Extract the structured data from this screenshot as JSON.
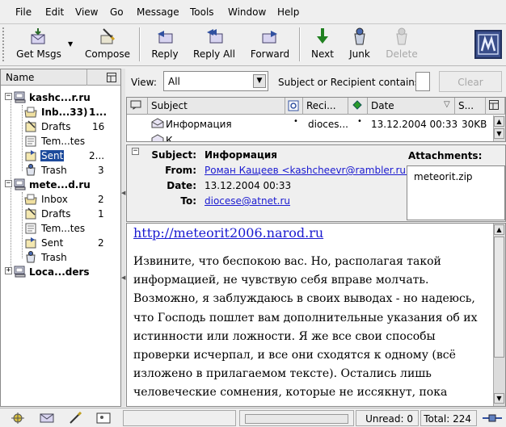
{
  "menubar": {
    "items": [
      "File",
      "Edit",
      "View",
      "Go",
      "Message",
      "Tools",
      "Window",
      "Help"
    ]
  },
  "toolbar": {
    "get_msgs": "Get Msgs",
    "compose": "Compose",
    "reply": "Reply",
    "reply_all": "Reply All",
    "forward": "Forward",
    "next": "Next",
    "junk": "Junk",
    "delete": "Delete"
  },
  "folder_pane": {
    "header": "Name",
    "accounts": [
      {
        "name": "kashc...r.ru",
        "folders": [
          {
            "name": "Inb...33)",
            "count": "1...",
            "bold": true
          },
          {
            "name": "Drafts",
            "count": "16"
          },
          {
            "name": "Tem...tes",
            "count": ""
          },
          {
            "name": "Sent",
            "count": "2...",
            "selected": true
          },
          {
            "name": "Trash",
            "count": "3"
          }
        ]
      },
      {
        "name": "mete...d.ru",
        "folders": [
          {
            "name": "Inbox",
            "count": "2"
          },
          {
            "name": "Drafts",
            "count": "1"
          },
          {
            "name": "Tem...tes",
            "count": ""
          },
          {
            "name": "Sent",
            "count": "2"
          },
          {
            "name": "Trash",
            "count": ""
          }
        ]
      },
      {
        "name": "Loca...ders",
        "folders": []
      }
    ]
  },
  "filter_bar": {
    "view_label": "View:",
    "view_value": "All",
    "search_label": "Subject or Recipient contains:",
    "search_value": "",
    "clear_label": "Clear"
  },
  "thread_pane": {
    "columns": [
      "Subject",
      "Reci...",
      "Date",
      "S..."
    ],
    "rows": [
      {
        "subject": "Информация",
        "recipient": "dioces...",
        "date": "13.12.2004 00:33",
        "size": "30KB"
      },
      {
        "subject": "К...",
        "recipient": "",
        "date": "",
        "size": ""
      }
    ]
  },
  "message_header": {
    "subject_label": "Subject:",
    "subject": "Информация",
    "from_label": "From:",
    "from": "Роман Кащеев <kashcheevr@rambler.ru>",
    "date_label": "Date:",
    "date": "13.12.2004 00:33",
    "to_label": "To:",
    "to": "diocese@atnet.ru",
    "attachments_label": "Attachments:",
    "attachment": "meteorit.zip"
  },
  "message_body": {
    "link": "http://meteorit2006.narod.ru",
    "text": "Извините, что беспокою вас. Но, располагая такой информацией, не чувствую себя вправе молчать. Возможно, я заблуждаюсь в своих выводах - но надеюсь, что Господь пошлет вам дополнительные указания об их истинности или ложности. Я же все свои способы проверки исчерпал, и все они сходятся к одному (всё изложено в прилагаемом тексте). Остались лишь человеческие сомнения, которые не иссякнут, пока событие не произойдет."
  },
  "status_bar": {
    "unread": "Unread: 0",
    "total": "Total: 224"
  },
  "colors": {
    "selection": "#1c4a9c",
    "link": "#1a1ad0"
  }
}
